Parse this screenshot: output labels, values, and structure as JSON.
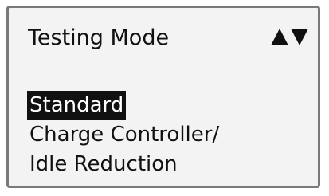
{
  "screen": {
    "title": "Testing Mode",
    "scroll_indicator": {
      "up_icon": "triangle-up",
      "down_icon": "triangle-down"
    },
    "menu": {
      "items": [
        {
          "label": "Standard",
          "selected": true
        },
        {
          "label": "Charge Controller/",
          "selected": false
        },
        {
          "label": "Idle Reduction",
          "selected": false
        }
      ]
    },
    "colors": {
      "background": "#f3f3f3",
      "text": "#111111",
      "highlight_bg": "#111111",
      "highlight_text": "#ffffff",
      "frame": "#7a7a7a"
    }
  }
}
